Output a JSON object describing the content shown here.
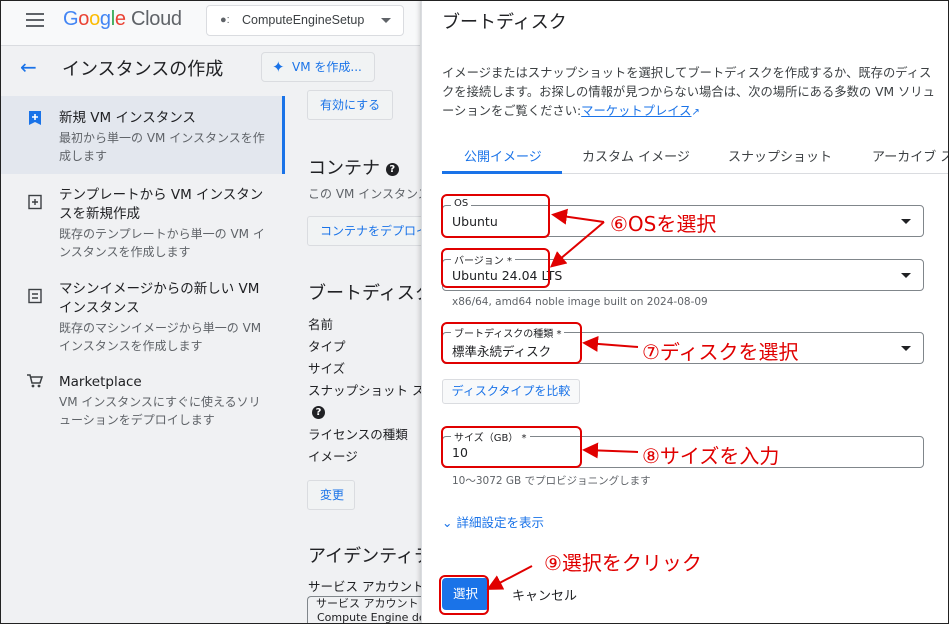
{
  "topbar": {
    "logo_text": "Google Cloud",
    "project_name": "ComputeEngineSetup"
  },
  "header": {
    "page_title": "インスタンスの作成",
    "create_vm_label": "VM を作成..."
  },
  "sidebar": {
    "items": [
      {
        "title": "新規 VM インスタンス",
        "desc": "最初から単一の VM インスタンスを作成します",
        "icon": "add-box-icon",
        "selected": true
      },
      {
        "title": "テンプレートから VM インスタンスを新規作成",
        "desc": "既存のテンプレートから単一の VM インスタンスを作成します",
        "icon": "template-icon",
        "selected": false
      },
      {
        "title": "マシンイメージからの新しい VM インスタンス",
        "desc": "既存のマシンイメージから単一の VM インスタンスを作成します",
        "icon": "machine-image-icon",
        "selected": false
      },
      {
        "title": "Marketplace",
        "desc": "VM インスタンスにすぐに使えるソリューションをデプロイします",
        "icon": "cart-icon",
        "selected": false
      }
    ]
  },
  "middle": {
    "enable_button": "有効にする",
    "container_heading": "コンテナ",
    "container_text": "この VM インスタンス",
    "container_deploy_button": "コンテナをデプロイ",
    "boot_disk_heading": "ブートディスク",
    "rows": [
      "名前",
      "タイプ",
      "サイズ",
      "スナップショット ス",
      "ライセンスの種類",
      "イメージ"
    ],
    "change_button": "変更",
    "identity_heading": "アイデンティティ",
    "service_account_label": "サービス アカウント",
    "service_account_field_label": "サービス アカウント",
    "service_account_value": "Compute Engine de"
  },
  "panel": {
    "title": "ブートディスク",
    "description": "イメージまたはスナップショットを選択してブートディスクを作成するか、既存のディスクを接続します。お探しの情報が見つからない場合は、次の場所にある多数の VM ソリューションをご覧ください:",
    "marketplace_link": "マーケットプレイス",
    "tabs": [
      "公開イメージ",
      "カスタム イメージ",
      "スナップショット",
      "アーカイブ ス"
    ],
    "os_label": "OS",
    "os_value": "Ubuntu",
    "version_label": "バージョン *",
    "version_value": "Ubuntu 24.04 LTS",
    "version_hint": "x86/64, amd64 noble image built on 2024-08-09",
    "disk_type_label": "ブートディスクの種類 *",
    "disk_type_value": "標準永続ディスク",
    "compare_button": "ディスクタイプを比較",
    "size_label": "サイズ（GB） *",
    "size_value": "10",
    "size_hint": "10～3072 GB でプロビジョニングします",
    "advanced_link": "詳細設定を表示",
    "select_button": "選択",
    "cancel_button": "キャンセル"
  },
  "annotations": {
    "step6": "⑥OSを選択",
    "step7": "⑦ディスクを選択",
    "step8": "⑧サイズを入力",
    "step9": "⑨選択をクリック"
  },
  "colors": {
    "accent": "#1a73e8",
    "annotation": "#e00000"
  }
}
